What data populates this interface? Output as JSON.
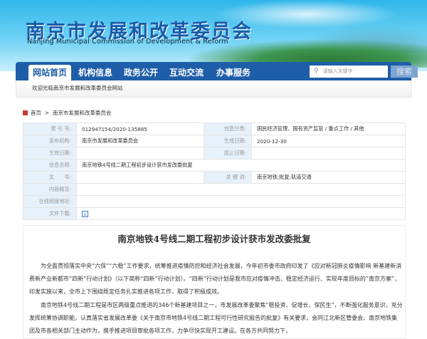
{
  "header": {
    "title": "南京市发展和改革委员会",
    "subtitle": "Nanjing Municipal Commission of Development & Reform"
  },
  "nav": {
    "items": [
      "网站首页",
      "机构信息",
      "政务公开",
      "互动交流",
      "办事服务"
    ],
    "search_placeholder": "请输入关键字",
    "search_button": "搜索"
  },
  "welcome": "欢迎光临南京市发展和改革委员会网站",
  "breadcrumb": {
    "home": "首页",
    "sep": ">",
    "current": "南京市发展和改革委员会"
  },
  "info": {
    "index_label": "索 引 号:",
    "index": "012947154/2020-135885",
    "category_label": "信息分类:",
    "category": "国民经济管理、国有资产监管 / 重点工作 / 其他",
    "publisher_label": "发布机构:",
    "publisher": "南京市发展和改革委员会",
    "date_label": "生成日期:",
    "date": "2020-12-30",
    "effective_label": "生效日期:",
    "effective": "",
    "expire_label": "废止日期:",
    "expire": "",
    "name_label": "信息名称:",
    "name": "南京地铁4号线二期工程初步设计获市发改委批复",
    "docno_label": "文　　号:",
    "docno": "",
    "keywords_label": "关 键 词:",
    "keywords": "南京地铁;批复;轨道交通",
    "summary_label": "内容概览:",
    "summary": "",
    "link_label": "在线链接地址:",
    "link": "",
    "download_label": "文件下载:"
  },
  "article": {
    "title": "南京地铁4号线二期工程初步设计获市发改委批复",
    "paragraphs": [
      "为全面贯彻落实中央“六保”“六稳”工作要求，统筹推进疫情防控和经济社会发展，今年初市委市政府印发了《应对新冠肺炎疫情影响 新基建新消费新产业新都市“四新”行动计划》（以下简称“四新”行动计划）。“四新”行动计划是我市应对疫情冲击、稳定经济运行、实现年度目标的“南京方案”，印发实施以来，全市上下围绕既定任务扎实推进各项工作，取得了积极成效。",
      "南京地铁4号线二期工程是市区两级重点推进的346个新基建项目之一，市发展改革委聚焦“稳投资、促增长、保民生”，不断强化服务意识，充分发挥统筹协调职能，认真落实省发展改革委《关于南京市地铁4号线二期工程可行性研究报告的批复》有关要求，会同江北新区管委会、南京地铁集团及市各相关部门主动作为，携手推进项目审批各项工作，力争尽快实现开工建设。在各方共同努力下，"
    ]
  }
}
